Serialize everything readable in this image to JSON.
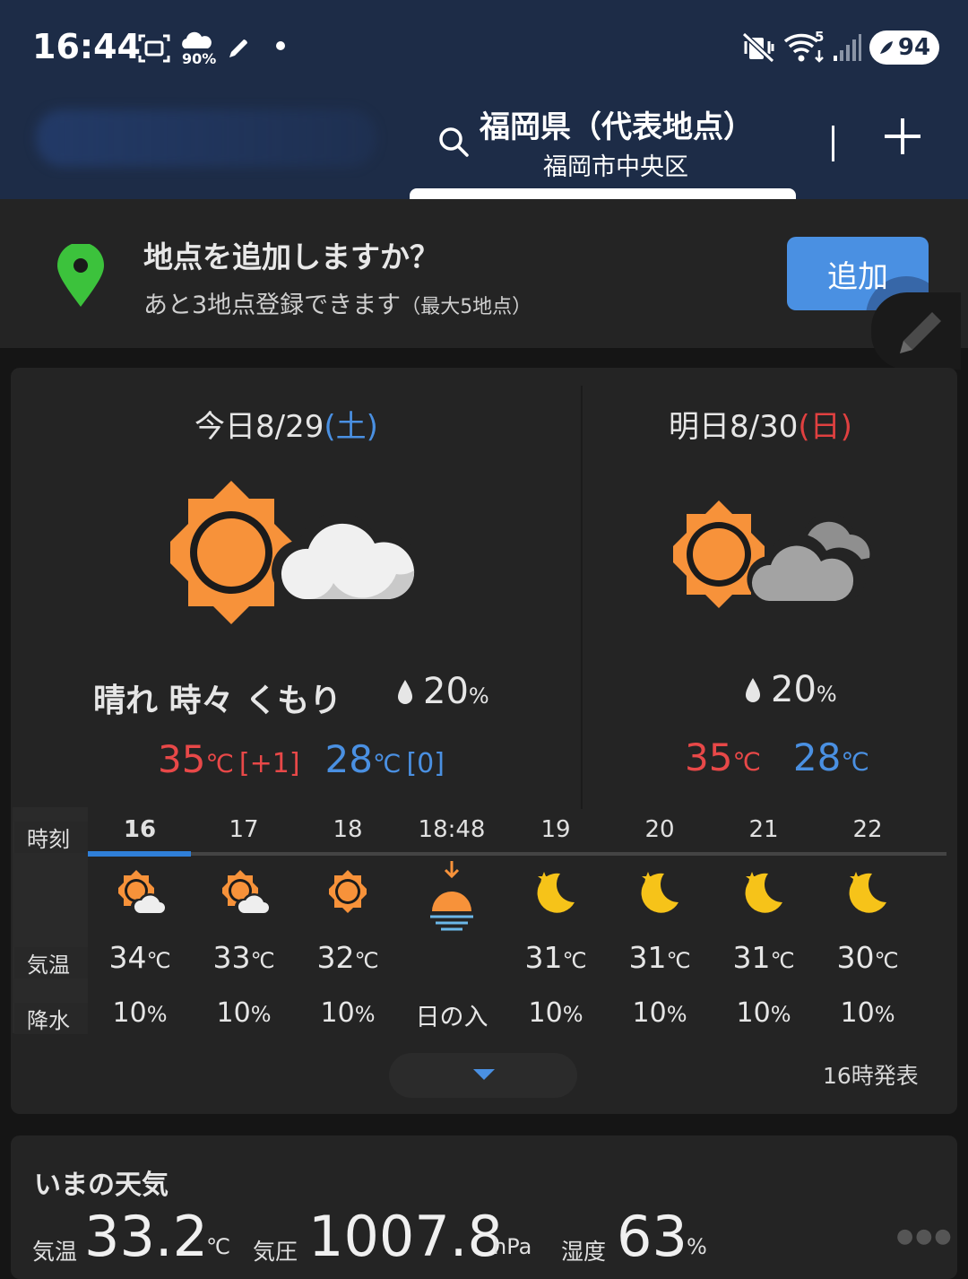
{
  "status_bar": {
    "time": "16:44",
    "rain_badge": "90%",
    "network": "5",
    "battery": "94",
    "icons": [
      "screenshot-icon",
      "umbrella-cloud-icon",
      "rocket-icon",
      "dot-icon",
      "mute-vibrate-icon",
      "wifi-icon",
      "signal-icon",
      "battery-saver-icon"
    ]
  },
  "header": {
    "location_title": "福岡県（代表地点）",
    "location_sub": "福岡市中央区"
  },
  "banner": {
    "title": "地点を追加しますか？",
    "sub_main": "あと3地点登録できます",
    "sub_note": "（最大5地点）",
    "add_label": "追加"
  },
  "today": {
    "label": "今日8/29",
    "weekday": "(土)",
    "condition": "晴れ 時々 くもり",
    "pop": "20",
    "pop_unit": "%",
    "high": "35",
    "high_diff": "[+1]",
    "low": "28",
    "low_diff": "[0]",
    "temp_unit": "℃"
  },
  "tomorrow": {
    "label": "明日8/30",
    "weekday": "(日)",
    "pop": "20",
    "pop_unit": "%",
    "high": "35",
    "low": "28",
    "temp_unit": "℃"
  },
  "hourly": {
    "labels": {
      "time": "時刻",
      "temp": "気温",
      "rain": "降水"
    },
    "items": [
      {
        "hour": "16",
        "icon": "sun-cloud-icon",
        "temp": "34",
        "rain": "10",
        "unit": "℃",
        "rain_unit": "%"
      },
      {
        "hour": "17",
        "icon": "sun-cloud-icon",
        "temp": "33",
        "rain": "10",
        "unit": "℃",
        "rain_unit": "%"
      },
      {
        "hour": "18",
        "icon": "sun-icon",
        "temp": "32",
        "rain": "10",
        "unit": "℃",
        "rain_unit": "%"
      },
      {
        "hour": "18:48",
        "icon": "sunset-icon",
        "sunset_label": "日の入"
      },
      {
        "hour": "19",
        "icon": "moon-star-icon",
        "temp": "31",
        "rain": "10",
        "unit": "℃",
        "rain_unit": "%"
      },
      {
        "hour": "20",
        "icon": "moon-star-icon",
        "temp": "31",
        "rain": "10",
        "unit": "℃",
        "rain_unit": "%"
      },
      {
        "hour": "21",
        "icon": "moon-star-icon",
        "temp": "31",
        "rain": "10",
        "unit": "℃",
        "rain_unit": "%"
      },
      {
        "hour": "22",
        "icon": "moon-star-icon",
        "temp": "30",
        "rain": "10",
        "unit": "℃",
        "rain_unit": "%"
      }
    ],
    "published": "16時発表"
  },
  "current": {
    "title": "いまの天気",
    "temp_label": "気温",
    "temp": "33.2",
    "temp_unit": "℃",
    "pressure_label": "気圧",
    "pressure": "1007.8",
    "pressure_unit": "hPa",
    "humidity_label": "湿度",
    "humidity": "63",
    "humidity_unit": "%"
  },
  "colors": {
    "header_bg": "#1d2c47",
    "accent_blue": "#4a90e2",
    "high_red": "#e84848",
    "sun_orange": "#f7923a",
    "moon_yellow": "#f6c319",
    "pin_green": "#3cc23c"
  }
}
